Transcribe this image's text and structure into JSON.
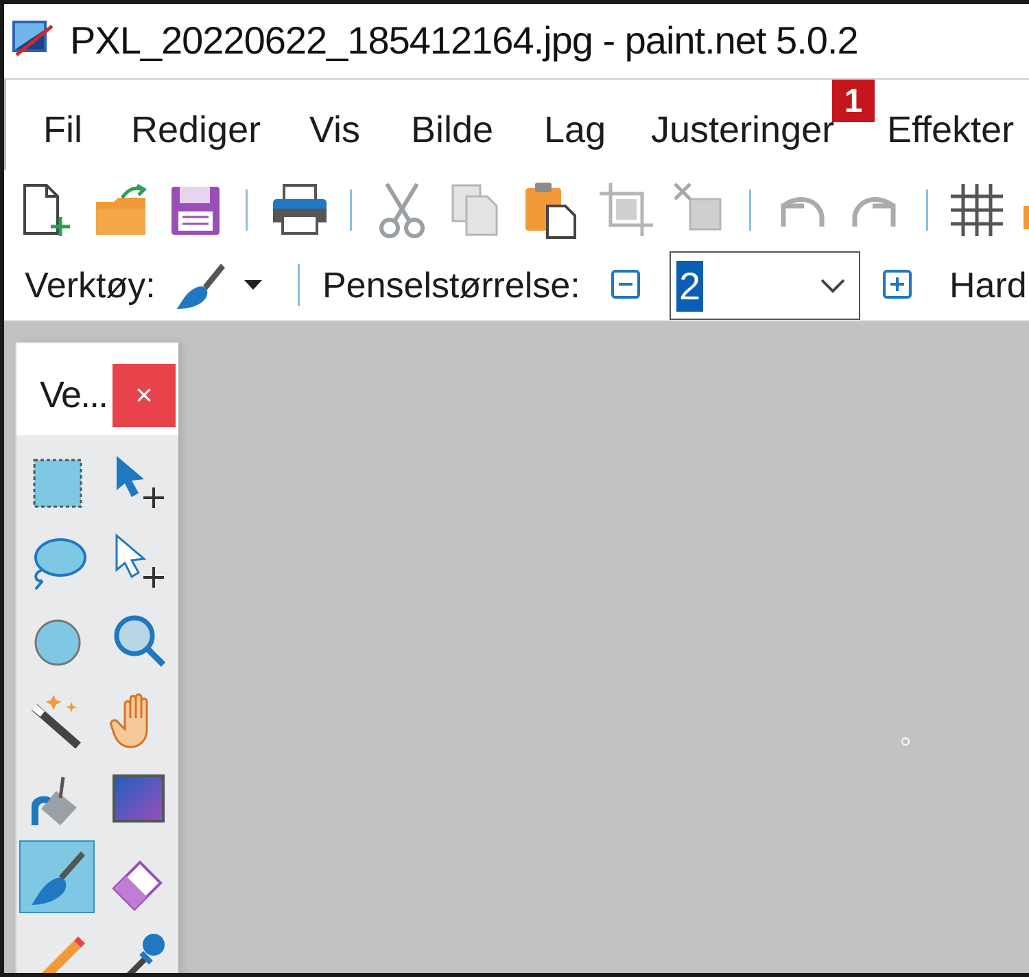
{
  "window": {
    "title": "PXL_20220622_185412164.jpg - paint.net 5.0.2"
  },
  "menu": {
    "items": [
      "Fil",
      "Rediger",
      "Vis",
      "Bilde",
      "Lag",
      "Justeringer",
      "Effekter"
    ],
    "badge": "1"
  },
  "toolbar": {
    "buttons": [
      "new-file-icon",
      "open-folder-icon",
      "save-icon",
      "print-icon",
      "cut-icon",
      "copy-icon",
      "paste-icon",
      "crop-icon",
      "deselect-icon",
      "undo-icon",
      "redo-icon",
      "grid-icon"
    ]
  },
  "options": {
    "tool_label": "Verktøy:",
    "brush_size_label": "Penselstørrelse:",
    "brush_size_value": "2",
    "hardness_label": "Hard"
  },
  "tools_panel": {
    "title": "Ve...",
    "close_label": "×",
    "active_tool": "paintbrush",
    "tools": [
      "rectangle-select",
      "move-selection",
      "lasso-select",
      "move-selected-outline",
      "ellipse-select",
      "zoom",
      "magic-wand",
      "pan",
      "paint-bucket",
      "gradient",
      "paintbrush",
      "eraser",
      "pencil",
      "color-picker"
    ]
  },
  "colors": {
    "accent": "#0a5fb4",
    "close": "#e8434b",
    "badge": "#c4161c",
    "canvas": "#c1c3c2"
  }
}
